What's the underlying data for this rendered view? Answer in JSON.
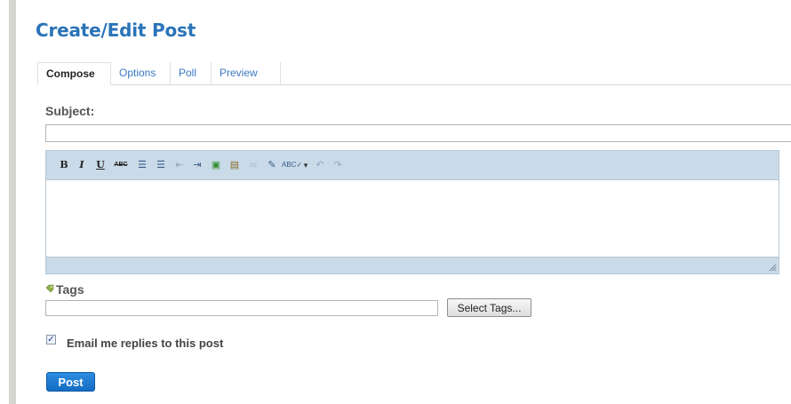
{
  "page": {
    "title": "Create/Edit Post"
  },
  "tabs": [
    {
      "label": "Compose",
      "active": true
    },
    {
      "label": "Options",
      "active": false
    },
    {
      "label": "Poll",
      "active": false
    },
    {
      "label": "Preview",
      "active": false
    }
  ],
  "subject": {
    "label": "Subject:",
    "value": ""
  },
  "editor": {
    "toolbar": [
      {
        "name": "bold-icon",
        "glyph": "B"
      },
      {
        "name": "italic-icon",
        "glyph": "I"
      },
      {
        "name": "underline-icon",
        "glyph": "U"
      },
      {
        "name": "strikethrough-icon",
        "glyph": "ABC"
      },
      {
        "name": "bullet-list-icon",
        "glyph": "☰"
      },
      {
        "name": "numbered-list-icon",
        "glyph": "☰"
      },
      {
        "name": "outdent-icon",
        "glyph": "⇤"
      },
      {
        "name": "indent-icon",
        "glyph": "⇥"
      },
      {
        "name": "insert-image-icon",
        "glyph": "▣"
      },
      {
        "name": "paste-icon",
        "glyph": "▤"
      },
      {
        "name": "link-icon",
        "glyph": "∞"
      },
      {
        "name": "edit-html-icon",
        "glyph": "✎"
      },
      {
        "name": "spellcheck-icon",
        "glyph": "ABC✓"
      },
      {
        "name": "dropdown-arrow-icon",
        "glyph": "▾"
      },
      {
        "name": "undo-icon",
        "glyph": "↶"
      },
      {
        "name": "redo-icon",
        "glyph": "↷"
      }
    ],
    "content": ""
  },
  "tags": {
    "label": "Tags",
    "value": "",
    "button_label": "Select Tags..."
  },
  "email": {
    "label": "Email me replies to this post",
    "checked": true
  },
  "post_button": {
    "label": "Post"
  },
  "colors": {
    "title": "#2a73b8",
    "tab_link": "#3a79c2",
    "toolbar_bg": "#c9dbe8",
    "post_button": "#1a7bd2"
  }
}
